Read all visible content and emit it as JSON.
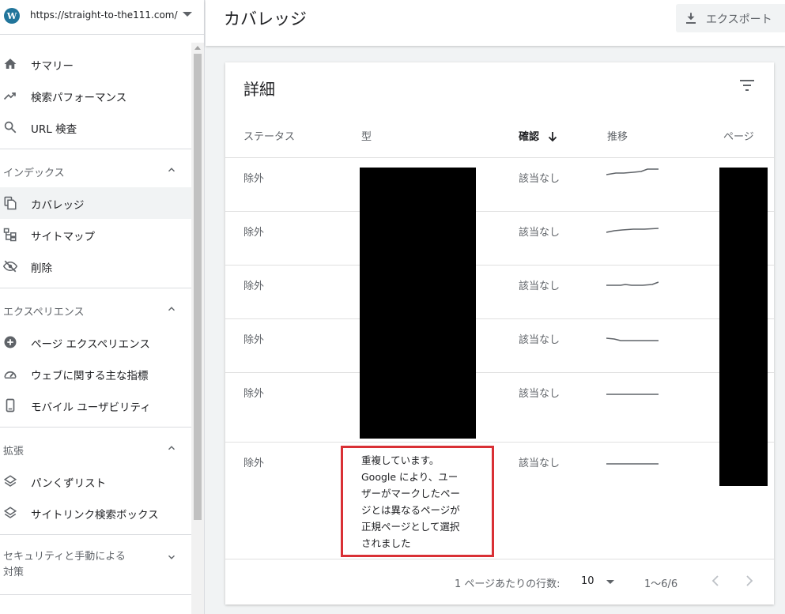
{
  "property": {
    "url": "https://straight-to-the111.com/"
  },
  "sidebar": {
    "top_items": [
      {
        "label": "サマリー",
        "icon": "home-icon"
      },
      {
        "label": "検索パフォーマンス",
        "icon": "trending-up-icon"
      },
      {
        "label": "URL 検査",
        "icon": "search-icon"
      }
    ],
    "sections": [
      {
        "title": "インデックス",
        "items": [
          {
            "label": "カバレッジ",
            "icon": "file-copy-icon",
            "active": true
          },
          {
            "label": "サイトマップ",
            "icon": "sitemap-icon"
          },
          {
            "label": "削除",
            "icon": "eye-off-icon"
          }
        ]
      },
      {
        "title": "エクスペリエンス",
        "items": [
          {
            "label": "ページ エクスペリエンス",
            "icon": "plus-circle-icon"
          },
          {
            "label": "ウェブに関する主な指標",
            "icon": "speedometer-icon"
          },
          {
            "label": "モバイル ユーザビリティ",
            "icon": "smartphone-icon"
          }
        ]
      },
      {
        "title": "拡張",
        "items": [
          {
            "label": "パンくずリスト",
            "icon": "layers-icon"
          },
          {
            "label": "サイトリンク検索ボックス",
            "icon": "layers-icon"
          }
        ]
      },
      {
        "title": "セキュリティと手動による\n対策",
        "items": []
      }
    ]
  },
  "header": {
    "title": "カバレッジ",
    "export_label": "エクスポート"
  },
  "details": {
    "title": "詳細",
    "columns": [
      "ステータス",
      "型",
      "確認",
      "推移",
      "ページ"
    ],
    "rows": [
      {
        "status": "除外",
        "validation": "該当なし"
      },
      {
        "status": "除外",
        "validation": "該当なし"
      },
      {
        "status": "除外",
        "validation": "該当なし"
      },
      {
        "status": "除外",
        "validation": "該当なし"
      },
      {
        "status": "除外",
        "validation": "該当なし"
      },
      {
        "status": "除外",
        "validation": "該当なし"
      }
    ],
    "highlight_text": "重複しています。\nGoogle により、ユー\nザーがマークしたペー\nジとは異なるページが\n正規ページとして選択\nされました",
    "footer": {
      "rows_per_page_label": "1 ページあたりの行数:",
      "rows_per_page_value": "10",
      "range": "1〜6/6"
    }
  },
  "colors": {
    "highlight_border": "#d93035",
    "redaction": "#000000"
  }
}
